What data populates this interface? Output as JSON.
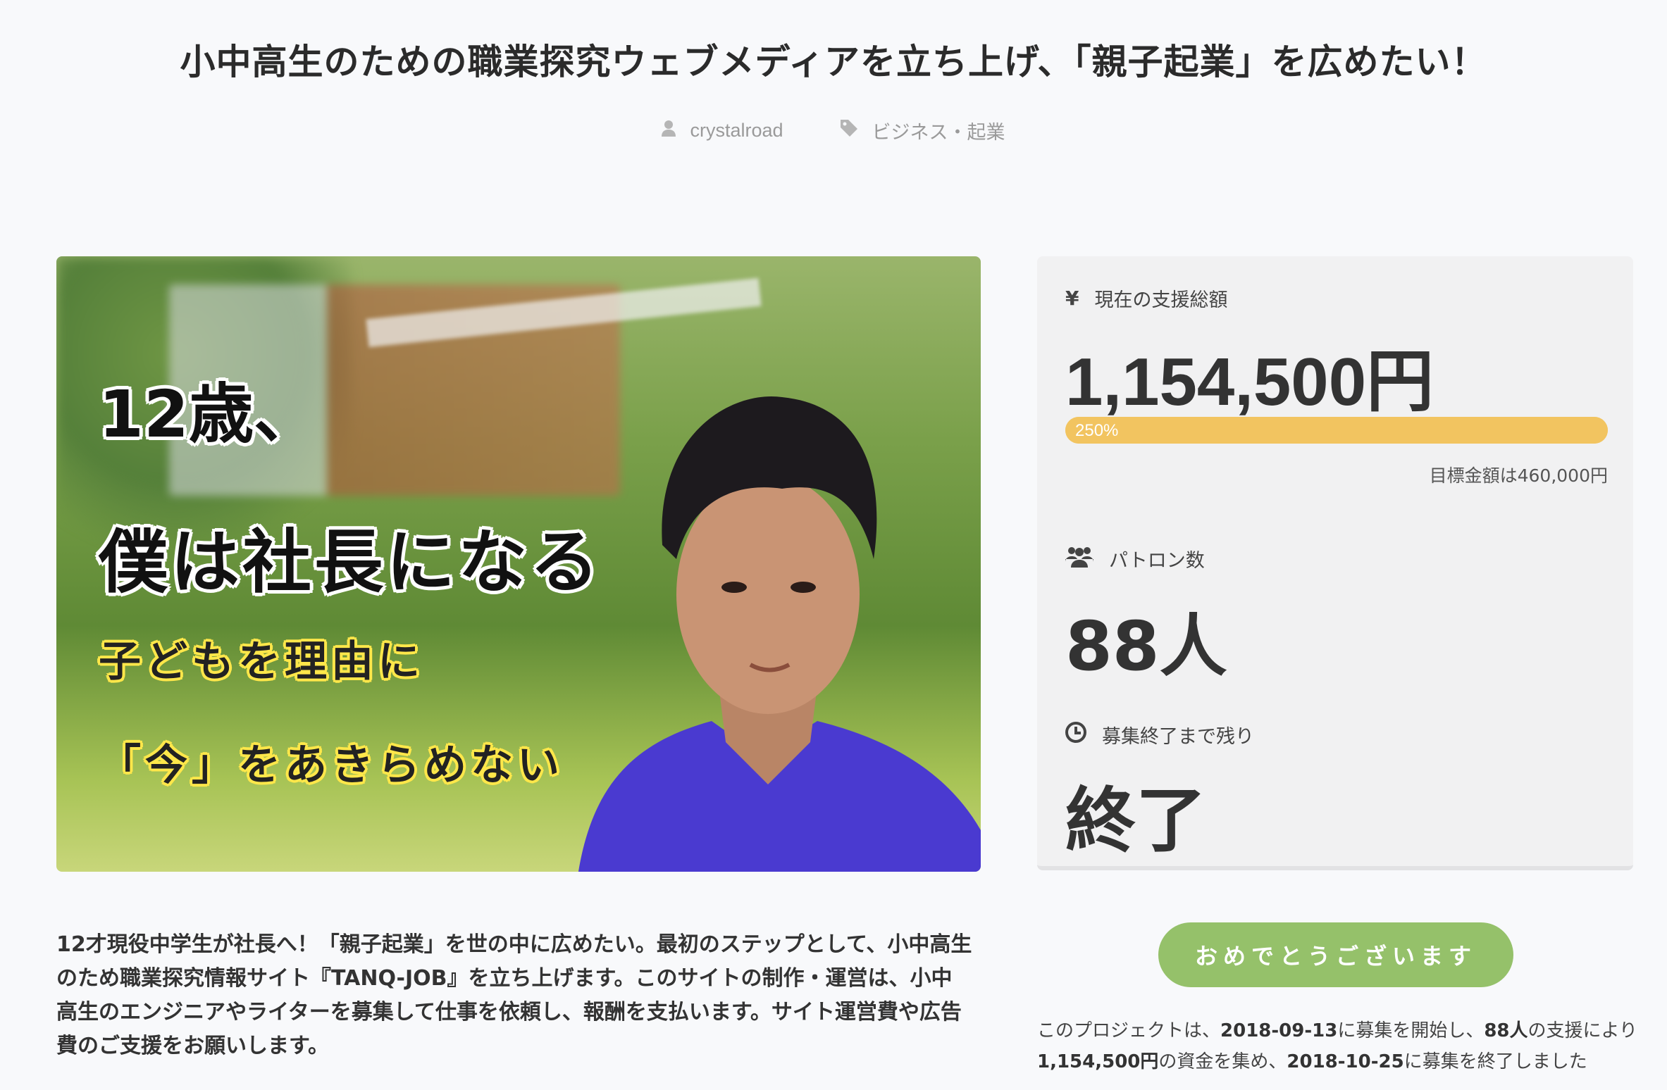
{
  "page": {
    "title": "小中高生のための職業探究ウェブメディアを立ち上げ、「親子起業」を広めたい！",
    "author": "crystalroad",
    "category": "ビジネス・起業"
  },
  "hero": {
    "line1": "12歳、",
    "line2": "僕は社長になる",
    "line3": "子どもを理由に",
    "line4": "「今」をあきらめない"
  },
  "summary": "12才現役中学生が社長へ！「親子起業」を世の中に広めたい。最初のステップとして、小中高生のため職業探究情報サイト『TANQ-JOB』を立ち上げます。このサイトの制作・運営は、小中高生のエンジニアやライターを募集して仕事を依頼し、報酬を支払います。サイト運営費や広告費のご支援をお願いします。",
  "stats": {
    "total_label": "現在の支援総額",
    "total_amount": "1,154,500円",
    "progress_text": "250%",
    "progress_fraction": 1.0,
    "goal_text": "目標金額は460,000円",
    "patrons_label": "パトロン数",
    "patrons_value": "88人",
    "remaining_label": "募集終了まで残り",
    "remaining_value": "終了",
    "currency_symbol": "¥"
  },
  "cta": {
    "label": "おめでとうございます"
  },
  "result": {
    "p1": "このプロジェクトは、",
    "start_date": "2018-09-13",
    "p2": "に募集を開始し、",
    "patrons": "88人",
    "p3": "の支援により",
    "amount": "1,154,500円",
    "p4": "の資金を集め、",
    "end_date": "2018-10-25",
    "p5": "に募集を終了しました"
  },
  "colors": {
    "progress": "#f2c460",
    "cta": "#95c16a",
    "panel": "#f1f1f2"
  },
  "icons": [
    "user-icon",
    "tag-icon",
    "yen-icon",
    "users-icon",
    "clock-icon"
  ]
}
